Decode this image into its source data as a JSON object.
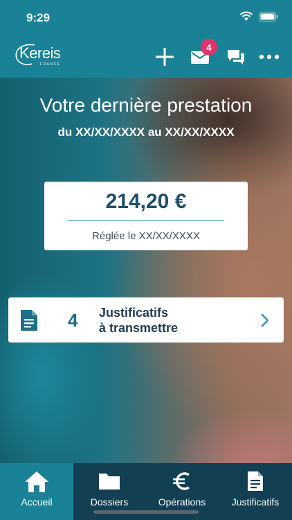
{
  "status_bar": {
    "time": "9:29"
  },
  "header": {
    "logo_text": "Kereis",
    "logo_sub": "FRANCE",
    "messages_badge": "4"
  },
  "hero": {
    "title": "Votre dernière prestation",
    "dates": "du XX/XX/XXXX au XX/XX/XXXX"
  },
  "amount_card": {
    "amount": "214,20 €",
    "status": "Réglée le XX/XX/XXXX"
  },
  "justificatifs_card": {
    "count": "4",
    "label_line1": "Justificatifs",
    "label_line2": "à transmettre"
  },
  "tabs": [
    {
      "label": "Accueil",
      "icon": "home-icon",
      "active": true
    },
    {
      "label": "Dossiers",
      "icon": "folder-icon",
      "active": false
    },
    {
      "label": "Opérations",
      "icon": "euro-icon",
      "active": false
    },
    {
      "label": "Justificatifs",
      "icon": "document-icon",
      "active": false
    }
  ],
  "colors": {
    "brand_teal": "#1a8296",
    "tabbar_dark": "#123f52",
    "badge_pink": "#e2336b",
    "amount_navy": "#1f4e6a"
  }
}
